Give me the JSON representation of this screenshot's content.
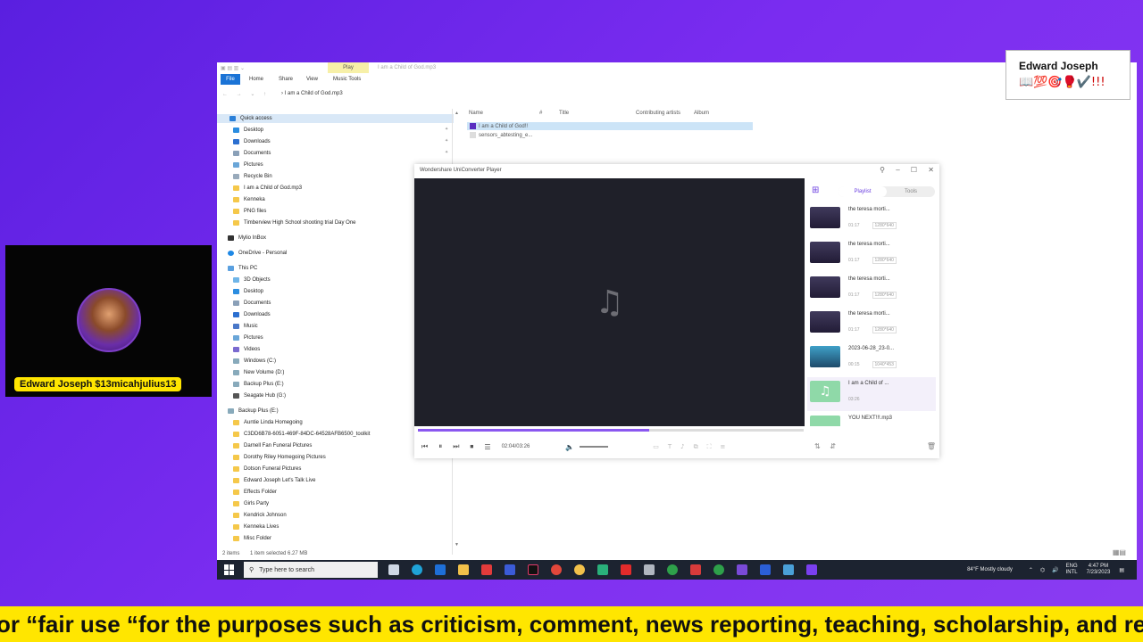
{
  "explorer": {
    "window_title": "I am a Child of God.mp3",
    "contextual_tab": "Play",
    "tabs": [
      "File",
      "Home",
      "Share",
      "View",
      "Music Tools"
    ],
    "address_path": "I am a Child of God.mp3",
    "nav": {
      "quick_access": "Quick access",
      "quick_items": [
        "Desktop",
        "Downloads",
        "Documents",
        "Pictures",
        "Recycle Bin",
        "I am a Child of God.mp3",
        "Kenneka",
        "PNG files",
        "Timberview High School shooting trial Day One"
      ],
      "mylio": "Mylio InBox",
      "onedrive": "OneDrive - Personal",
      "this_pc": "This PC",
      "pc_items": [
        "3D Objects",
        "Desktop",
        "Documents",
        "Downloads",
        "Music",
        "Pictures",
        "Videos",
        "Windows (C:)",
        "New Volume (D:)",
        "Backup Plus (E:)",
        "Seagate Hub (G:)"
      ],
      "backup": "Backup Plus (E:)",
      "backup_items": [
        "Auntie Linda Homegoing",
        "C3DD6B78-6051-469F-84DC-64528AFB6500_toolkit",
        "Darnell Fan Funeral Pictures",
        "Dorothy Riley Homegoing Pictures",
        "Dotson Funeral Pictures",
        "Edward Joseph Let's Talk Live",
        "Effects Folder",
        "Girls Party",
        "Kendrick Johnson",
        "Kenneka Lives",
        "Misc Folder"
      ]
    },
    "columns": [
      "Name",
      "#",
      "Title",
      "Contributing artists",
      "Album"
    ],
    "files": [
      "I am a Child of God!!",
      "sensors_abtesting_e..."
    ],
    "status": {
      "count": "2 items",
      "selection": "1 item selected 6.27 MB"
    }
  },
  "player": {
    "title": "Wondershare UniConverter Player",
    "time": "02:04/03:26",
    "progress": 0.6,
    "tabs": {
      "playlist": "Playlist",
      "tools": "Tools"
    },
    "items": [
      {
        "name": "the teresa morti...",
        "duration": "01:17",
        "res": "1280*640"
      },
      {
        "name": "the teresa morti...",
        "duration": "01:17",
        "res": "1280*640"
      },
      {
        "name": "the teresa morti...",
        "duration": "01:17",
        "res": "1280*640"
      },
      {
        "name": "the teresa morti...",
        "duration": "01:17",
        "res": "1280*640"
      },
      {
        "name": "2023-06-28_23-0...",
        "duration": "00:15",
        "res": "1040*453"
      },
      {
        "name": "I am a Child of ...",
        "duration": "03:26",
        "res": ""
      },
      {
        "name": "YOU NEXT!!!.mp3",
        "duration": "",
        "res": ""
      }
    ]
  },
  "taskbar": {
    "search_placeholder": "Type here to search",
    "weather": "84°F  Mostly cloudy",
    "lang": "ENG",
    "lang2": "INTL",
    "time": "4:47 PM",
    "date": "7/23/2023"
  },
  "overlay": {
    "card_name": "Edward Joseph",
    "card_emojis": "📖💯🎯🥊✔️!!!",
    "cam_label": "Edward Joseph $13micahjulius13",
    "ticker": "or “fair use “for the purposes such as criticism, comment, news reporting, teaching, scholarship, and resea"
  },
  "colors": {
    "accent": "#6b3fe0",
    "ticker_bg": "#ffe600",
    "bg": "#6a24e8"
  }
}
